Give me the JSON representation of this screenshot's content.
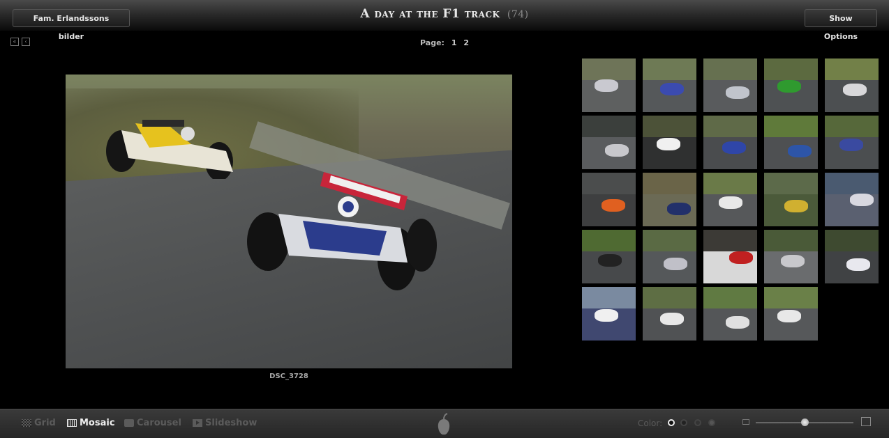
{
  "header": {
    "album_button": "Fam. Erlandssons bilder",
    "title": "A day at the F1 track",
    "count": "(74)",
    "options_button": "Show Options"
  },
  "pager": {
    "label": "Page:",
    "pages": [
      "1",
      "2"
    ]
  },
  "main_photo": {
    "caption": "DSC_3728"
  },
  "thumbnails": [
    {
      "top": "#6e7458",
      "bot": "#5e6060",
      "obj": "#c9c9d0"
    },
    {
      "top": "#6e7a55",
      "bot": "#55585a",
      "obj": "#3b4bb0"
    },
    {
      "top": "#667050",
      "bot": "#595b5d",
      "obj": "#c0c4cc"
    },
    {
      "top": "#5c6a40",
      "bot": "#4e5153",
      "obj": "#2f9a2f"
    },
    {
      "top": "#728048",
      "bot": "#4c4f51",
      "obj": "#d8d8da"
    },
    {
      "top": "#3b3f3c",
      "bot": "#5a5c5e",
      "obj": "#c8c8cc"
    },
    {
      "top": "#4c5238",
      "bot": "#2f3030",
      "obj": "#f0f0f0"
    },
    {
      "top": "#5f6a48",
      "bot": "#4a4c4e",
      "obj": "#2f46a8"
    },
    {
      "top": "#5f7a3a",
      "bot": "#4e5052",
      "obj": "#2d55a8"
    },
    {
      "top": "#56683a",
      "bot": "#4b4e50",
      "obj": "#3a4aa0"
    },
    {
      "top": "#4b4d4d",
      "bot": "#3e3f40",
      "obj": "#e06020"
    },
    {
      "top": "#6a6448",
      "bot": "#6b6a55",
      "obj": "#22306a"
    },
    {
      "top": "#6a7a48",
      "bot": "#56585a",
      "obj": "#e8e8e8"
    },
    {
      "top": "#5c6a4a",
      "bot": "#4b5a3a",
      "obj": "#d0b030"
    },
    {
      "top": "#4a5a70",
      "bot": "#5a6070",
      "obj": "#d8d8e0"
    },
    {
      "top": "#4f6a32",
      "bot": "#47494b",
      "obj": "#222222"
    },
    {
      "top": "#5a6a44",
      "bot": "#55585a",
      "obj": "#c0c0c8"
    },
    {
      "top": "#3c3a36",
      "bot": "#d8d8d8",
      "obj": "#c02020"
    },
    {
      "top": "#4a5a38",
      "bot": "#6a6c6e",
      "obj": "#c8c8cc"
    },
    {
      "top": "#3e4a30",
      "bot": "#404244",
      "obj": "#e8e8ee"
    },
    {
      "top": "#7a8aa0",
      "bot": "#404870",
      "obj": "#f0f0f0"
    },
    {
      "top": "#5e6e44",
      "bot": "#505254",
      "obj": "#e8e8e8"
    },
    {
      "top": "#607a42",
      "bot": "#545658",
      "obj": "#e0e0e0"
    },
    {
      "top": "#6a8048",
      "bot": "#56585a",
      "obj": "#e8e8e8"
    }
  ],
  "toolbar": {
    "views": [
      {
        "label": "Grid",
        "active": false
      },
      {
        "label": "Mosaic",
        "active": true
      },
      {
        "label": "Carousel",
        "active": false
      },
      {
        "label": "Slideshow",
        "active": false
      }
    ],
    "color_label": "Color:",
    "zoom_level": 0.5
  }
}
